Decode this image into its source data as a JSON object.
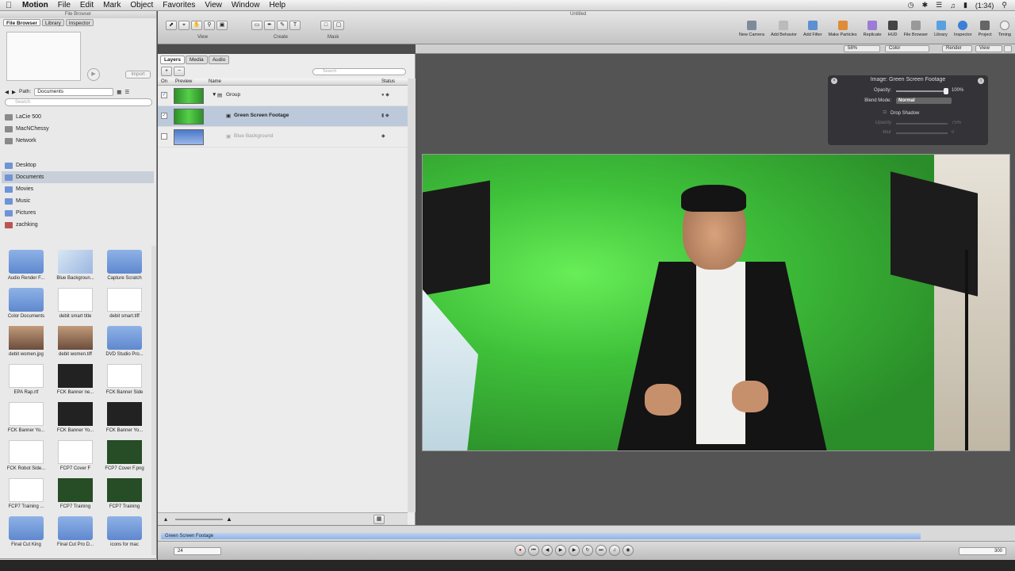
{
  "menubar": {
    "app_name": "Motion",
    "items": [
      "File",
      "Edit",
      "Mark",
      "Object",
      "Favorites",
      "View",
      "Window",
      "Help"
    ],
    "clock": "(1:34)"
  },
  "file_browser": {
    "window_title": "File Browser",
    "tabs": [
      "File Browser",
      "Library",
      "Inspector"
    ],
    "import_label": "Import",
    "path_label": "Path:",
    "path_value": "Documents",
    "search_placeholder": "Search",
    "devices": [
      {
        "name": "LaCie 500",
        "icon": "drive-icon"
      },
      {
        "name": "MacNChessy",
        "icon": "computer-icon"
      },
      {
        "name": "Network",
        "icon": "globe-icon"
      }
    ],
    "places": [
      {
        "name": "Desktop",
        "icon": "folder-icon"
      },
      {
        "name": "Documents",
        "icon": "folder-icon",
        "selected": true
      },
      {
        "name": "Movies",
        "icon": "folder-icon"
      },
      {
        "name": "Music",
        "icon": "folder-icon"
      },
      {
        "name": "Pictures",
        "icon": "folder-icon"
      },
      {
        "name": "zachking",
        "icon": "home-icon"
      }
    ],
    "files": [
      {
        "name": "Audio Render F...",
        "kind": "folder"
      },
      {
        "name": "Blue Backgroun...",
        "kind": "pic"
      },
      {
        "name": "Capture Scratch",
        "kind": "folder"
      },
      {
        "name": "Color Documents",
        "kind": "folder"
      },
      {
        "name": "debit smart title",
        "kind": "doc"
      },
      {
        "name": "debit smart.tiff",
        "kind": "doc"
      },
      {
        "name": "debit women.jpg",
        "kind": "photo"
      },
      {
        "name": "debit women.tiff",
        "kind": "photo"
      },
      {
        "name": "DVD Studio Pro...",
        "kind": "folder"
      },
      {
        "name": "EPA Rap.rtf",
        "kind": "doc"
      },
      {
        "name": "FCK Banner ne...",
        "kind": "darkth"
      },
      {
        "name": "FCK Banner Side",
        "kind": "doc"
      },
      {
        "name": "FCK Banner Yo...",
        "kind": "doc"
      },
      {
        "name": "FCK Banner Yo...",
        "kind": "darkth"
      },
      {
        "name": "FCK Banner Yo...",
        "kind": "darkth"
      },
      {
        "name": "FCK Robot Side...",
        "kind": "doc"
      },
      {
        "name": "FCP7 Cover F",
        "kind": "doc"
      },
      {
        "name": "FCP7 Cover F.png",
        "kind": "greenth"
      },
      {
        "name": "FCP7 Training ...",
        "kind": "doc"
      },
      {
        "name": "FCP7 Training",
        "kind": "greenth"
      },
      {
        "name": "FCP7 Training",
        "kind": "greenth"
      },
      {
        "name": "Final Cut King",
        "kind": "folder"
      },
      {
        "name": "Final Cut Pro D...",
        "kind": "folder"
      },
      {
        "name": "icons for mac",
        "kind": "folder"
      }
    ]
  },
  "toolbar": {
    "title": "Untitled",
    "group_labels": [
      "View",
      "Create",
      "Mask"
    ],
    "right_tools": [
      "New Camera",
      "Add Behavior",
      "Add Filter",
      "Make Particles",
      "Replicate",
      "HUD",
      "File Browser",
      "Library",
      "Inspector",
      "Project",
      "Timing"
    ],
    "zoom": "58%",
    "channel": "Color",
    "render": "Render",
    "view": "View"
  },
  "layers_panel": {
    "tabs": [
      "Layers",
      "Media",
      "Audio"
    ],
    "search_placeholder": "Search",
    "columns": [
      "On",
      "Preview",
      "Name",
      "Status"
    ],
    "rows": [
      {
        "name": "Group",
        "checked": true,
        "selected": false
      },
      {
        "name": "Green Screen Footage",
        "checked": true,
        "selected": true
      },
      {
        "name": "Blue Background",
        "checked": false,
        "selected": false
      }
    ]
  },
  "hud": {
    "title": "Image: Green Screen Footage",
    "opacity_label": "Opacity:",
    "opacity_value": "100%",
    "opacity_level": 1.0,
    "blend_label": "Blend Mode:",
    "blend_value": "Normal",
    "drop_shadow_label": "Drop Shadow",
    "shadow_opacity_label": "Opacity",
    "shadow_opacity_value": "75%",
    "blur_label": "Blur",
    "blur_value": "0"
  },
  "timeline": {
    "track_label": "Green Screen Footage",
    "current_frame": "24",
    "end_frame": "300"
  }
}
